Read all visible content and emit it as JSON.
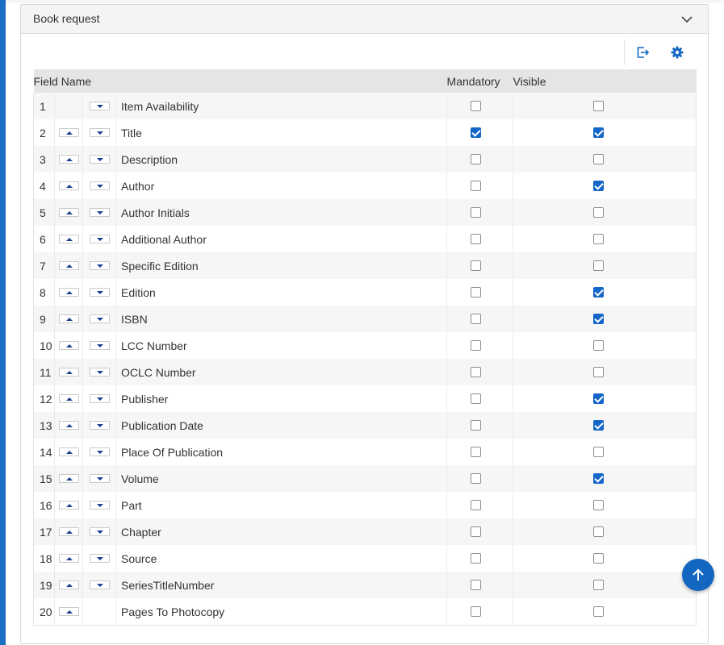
{
  "panel": {
    "title": "Book request",
    "collapse_icon": "chevron-down-icon"
  },
  "toolbar": {
    "export_icon": "export-icon",
    "settings_icon": "gear-icon"
  },
  "table": {
    "headers": {
      "field_name": "Field Name",
      "mandatory": "Mandatory",
      "visible": "Visible"
    },
    "rows": [
      {
        "num": "1",
        "name": "Item Availability",
        "mandatory": false,
        "visible": false,
        "up": false,
        "down": true
      },
      {
        "num": "2",
        "name": "Title",
        "mandatory": true,
        "visible": true,
        "up": true,
        "down": true
      },
      {
        "num": "3",
        "name": "Description",
        "mandatory": false,
        "visible": false,
        "up": true,
        "down": true
      },
      {
        "num": "4",
        "name": "Author",
        "mandatory": false,
        "visible": true,
        "up": true,
        "down": true
      },
      {
        "num": "5",
        "name": "Author Initials",
        "mandatory": false,
        "visible": false,
        "up": true,
        "down": true
      },
      {
        "num": "6",
        "name": "Additional Author",
        "mandatory": false,
        "visible": false,
        "up": true,
        "down": true
      },
      {
        "num": "7",
        "name": "Specific Edition",
        "mandatory": false,
        "visible": false,
        "up": true,
        "down": true
      },
      {
        "num": "8",
        "name": "Edition",
        "mandatory": false,
        "visible": true,
        "up": true,
        "down": true
      },
      {
        "num": "9",
        "name": "ISBN",
        "mandatory": false,
        "visible": true,
        "up": true,
        "down": true
      },
      {
        "num": "10",
        "name": "LCC Number",
        "mandatory": false,
        "visible": false,
        "up": true,
        "down": true
      },
      {
        "num": "11",
        "name": "OCLC Number",
        "mandatory": false,
        "visible": false,
        "up": true,
        "down": true
      },
      {
        "num": "12",
        "name": "Publisher",
        "mandatory": false,
        "visible": true,
        "up": true,
        "down": true
      },
      {
        "num": "13",
        "name": "Publication Date",
        "mandatory": false,
        "visible": true,
        "up": true,
        "down": true
      },
      {
        "num": "14",
        "name": "Place Of Publication",
        "mandatory": false,
        "visible": false,
        "up": true,
        "down": true
      },
      {
        "num": "15",
        "name": "Volume",
        "mandatory": false,
        "visible": true,
        "up": true,
        "down": true
      },
      {
        "num": "16",
        "name": "Part",
        "mandatory": false,
        "visible": false,
        "up": true,
        "down": true
      },
      {
        "num": "17",
        "name": "Chapter",
        "mandatory": false,
        "visible": false,
        "up": true,
        "down": true
      },
      {
        "num": "18",
        "name": "Source",
        "mandatory": false,
        "visible": false,
        "up": true,
        "down": true
      },
      {
        "num": "19",
        "name": "SeriesTitleNumber",
        "mandatory": false,
        "visible": false,
        "up": true,
        "down": true
      },
      {
        "num": "20",
        "name": "Pages To Photocopy",
        "mandatory": false,
        "visible": false,
        "up": true,
        "down": false
      }
    ]
  },
  "scroll_top_button": {
    "icon": "arrow-up-icon"
  },
  "colors": {
    "accent": "#1467c1",
    "checkbox_checked": "#1466c8",
    "move_arrow": "#1a3f8f",
    "left_bar": "#1b6fc4"
  }
}
